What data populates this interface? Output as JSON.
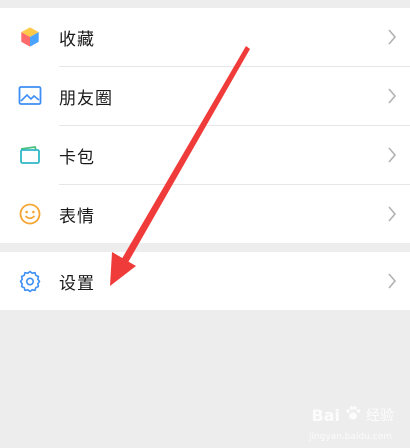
{
  "menu": {
    "items": [
      {
        "label": "收藏",
        "icon": "favorites-cube-icon"
      },
      {
        "label": "朋友圈",
        "icon": "moments-picture-icon"
      },
      {
        "label": "卡包",
        "icon": "card-wallet-icon"
      },
      {
        "label": "表情",
        "icon": "sticker-smiley-icon"
      }
    ],
    "settings": {
      "label": "设置",
      "icon": "gear-icon"
    }
  },
  "watermark": {
    "brand": "Bai",
    "sub": "经验",
    "url": "jingyan.baidu.com"
  },
  "colors": {
    "arrow": "#f03b3b",
    "background": "#ededed"
  }
}
